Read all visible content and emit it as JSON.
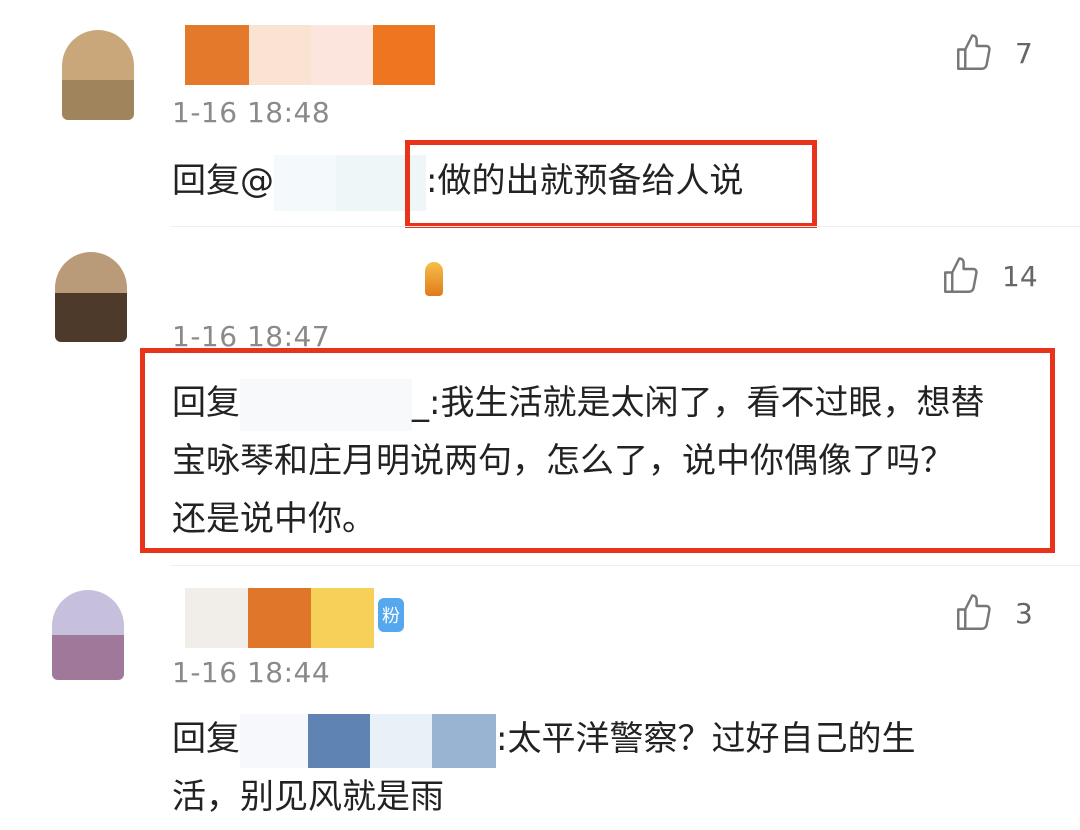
{
  "comments": [
    {
      "time": "1-16 18:48",
      "likes": "7",
      "reply_prefix": "回复@",
      "reply_text": ":做的出就预备给人说",
      "avatar_colors": [
        "#c9a77a",
        "#a0845c"
      ],
      "name_colors": [
        "#e5792b",
        "#fbe3d3",
        "#fbe5dc",
        "#ee7620"
      ]
    },
    {
      "time": "1-16 18:47",
      "likes": "14",
      "reply_prefix": "回复",
      "reply_line1": "_:我生活就是太闲了，看不过眼，想替",
      "reply_line2": "宝咏琴和庄月明说两句，怎么了，说中你偶像了吗？",
      "reply_line3": "还是说中你。",
      "avatar_colors": [
        "#b99a79",
        "#4d3a2a"
      ]
    },
    {
      "time": "1-16 18:44",
      "likes": "3",
      "badge": "粉",
      "reply_prefix": "回复",
      "reply_line1": ":太平洋警察？过好自己的生",
      "reply_line2": "活，别见风就是雨",
      "avatar_colors": [
        "#c7c0dc",
        "#a0789a"
      ],
      "name_colors": [
        "#f1eeea",
        "#e0762a",
        "#f7d05a"
      ],
      "mask_colors": [
        "#5f84b4",
        "#e9f1f8",
        "#98b4d2"
      ]
    }
  ],
  "colors": {
    "highlight": "#e8321a",
    "time": "#8a8a8a"
  },
  "icons": {
    "like": "thumb-up-icon"
  }
}
